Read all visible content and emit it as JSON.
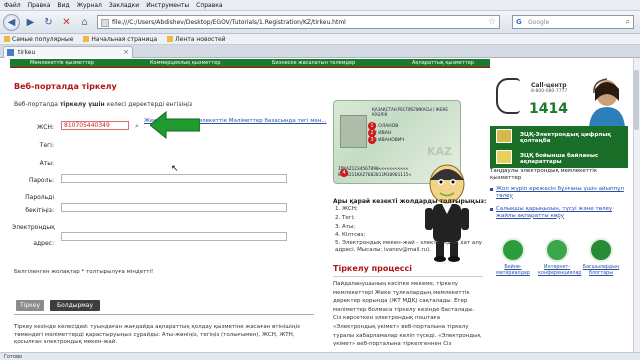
{
  "browser": {
    "menu": [
      "Файл",
      "Правка",
      "Вид",
      "Журнал",
      "Закладки",
      "Инструменты",
      "Справка"
    ],
    "url": "file:///C:/Users/Abdishev/Desktop/EGOV/Tutorials/1.Registration/KZ/tirkeu.html",
    "search_placeholder": "Google",
    "bookmarks": [
      "Самые популярные",
      "Начальная страница",
      "Лента новостей"
    ],
    "tab_title": "tirkeu",
    "status_text": "Готово"
  },
  "site": {
    "topnav": [
      "Мемлекеттік қызметтер",
      "Коммерциялық қызметтер",
      "Бизнеске жасалатын телемдер",
      "Ақпараттық қызметтер"
    ]
  },
  "form": {
    "title": "Веб-порталда тіркелу",
    "intro_prefix": "Веб-порталда ",
    "intro_bold": "тіркелу үшін",
    "intro_suffix": " келесі деректерді енгізіңіз",
    "labels": {
      "iin": "ЖСН:",
      "surname": "Тегі:",
      "name": "Аты:",
      "password": "Пароль:",
      "password_confirm_1": "Парольді",
      "password_confirm_2": "бекітіңіз:",
      "email_1": "Электрондық",
      "email_2": "адрес:"
    },
    "iin_value": "810705440349",
    "iin_link": "Жеке тұлғалар мемлекеттік Мәліметтер базасында тегі мен...",
    "required_note": "Белгіленген жолақтар * толтырылуға міндетті!",
    "btn_register": "Тіркеу",
    "btn_cancel": "Болдырмау",
    "bottom_text": "Тіркеу кезінде келесідей: туындаған жағдайда ақпараттық қолдау қызметіне жасаған өтінішіңіз төмендегі мәліметтерді қарастыруыңыз сұрайды: Аты-жөніңіз, тегіңіз (толығымен), ЖСН, ЖТН, қосылған электрондық мекен-жай."
  },
  "idcard": {
    "header": "ҚАЗАҚСТАН РЕСПУБЛИКАСЫ / ЖЕКЕ КУӘЛІК",
    "rows": [
      "1  ОЛАНОВ",
      "2  ИВАН",
      "3  ИВАНОВИЧ"
    ],
    "mrz_1": "IDKAZ1234567890<<<<<<<<<<<",
    "mrz_2": "8103211KAZ7602011M10901115<",
    "brand": "KAZ"
  },
  "required_fields": {
    "title": "Ары қарай кезекті жолдарды толтырыңыз:",
    "items": [
      "1. ЖСН;",
      "2. Тегі;",
      "3. Аты;",
      "4. Кілтсөз;",
      "5. Электрондық мекен-жай - электрондық хат алу адресі. Мысалы: ivanov@mail.ru)."
    ]
  },
  "process": {
    "title": "Тіркелу процессі",
    "text": "Пайдаланушының кәсіпке мекеме, тіркелу мемлекеттері Жеке тұлғалардың мемлекеттік деректер қорында (ЖТ МДҚ) сақталады. Егер мәліметтер болмаса тіркелу кезінде басталады. Сіз көрсеткен электрондық поштаға «Электрондық үкімет» веб-порталына тіркелу туралы хабарламалар келіп түседі. «Электрондық үкімет» веб-порталына тіркелгеннен Сіз"
  },
  "sidebar": {
    "callcenter_title": "Call-центр",
    "callcenter_phone": "8-800-080-7777",
    "callcenter_short": "1414",
    "green_btn_1": "ЭЦҚ-Электрондық цифрлық қолтаңба",
    "green_btn_2_line1": "ЭЦҚ бойынша байланыс",
    "green_btn_2_line2": "ақпараттары",
    "popular_title": "Таңдаулы электрондық мемлекеттік қызметтер",
    "links": [
      "Жол жүріп ережесін бұзғаны үшін айыппұл төлеу",
      "Салықшы қарыңызын, түсуі және төлеу жайлы ақпаратты көру"
    ],
    "tiles": [
      "Бейне-материалдар",
      "Интернет-конференциялар",
      "Басшылардың блогтары"
    ]
  }
}
